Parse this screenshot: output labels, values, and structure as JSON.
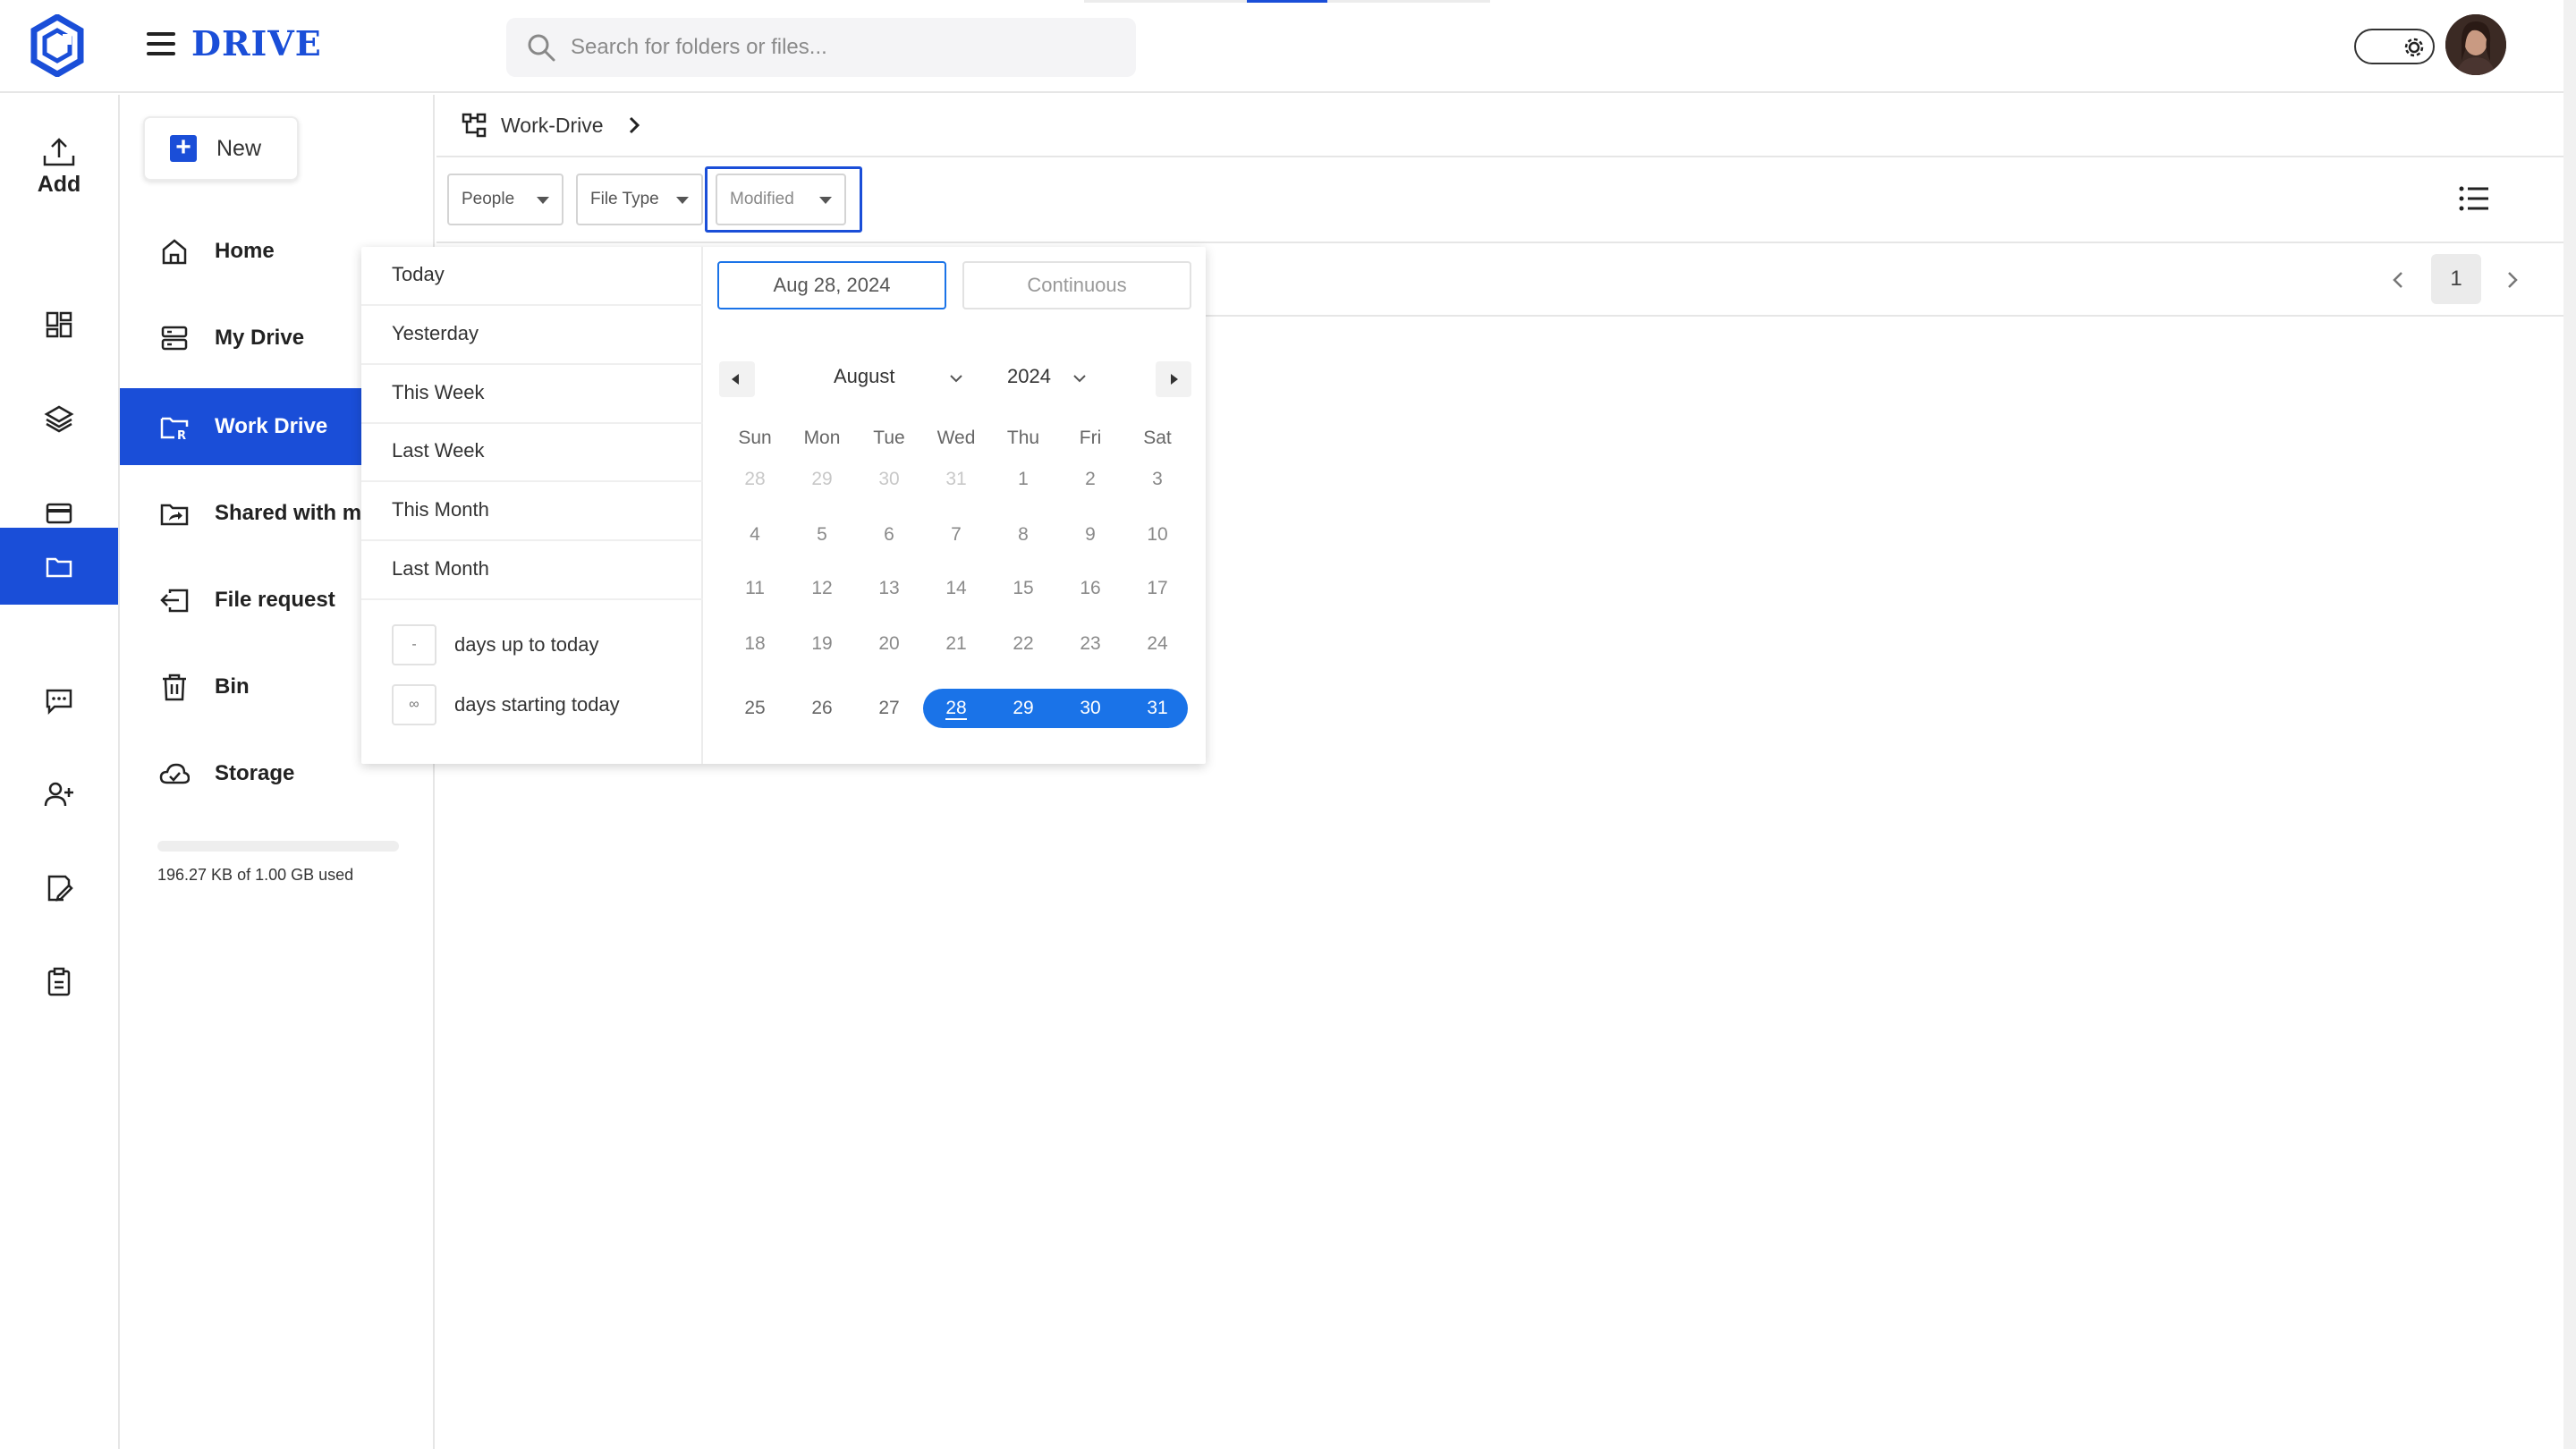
{
  "header": {
    "app_title": "DRIVE",
    "search_placeholder": "Search for folders or files..."
  },
  "rail": {
    "add_label": "Add",
    "items": [
      {
        "name": "dashboard-icon"
      },
      {
        "name": "layers-icon"
      },
      {
        "name": "card-icon"
      },
      {
        "name": "folder-icon",
        "active": true
      },
      {
        "name": "chat-icon"
      },
      {
        "name": "add-user-icon"
      },
      {
        "name": "edit-document-icon"
      },
      {
        "name": "clipboard-icon"
      }
    ]
  },
  "sidebar": {
    "new_label": "New",
    "items": [
      {
        "label": "Home",
        "icon": "home-icon"
      },
      {
        "label": "My Drive",
        "icon": "server-icon"
      },
      {
        "label": "Work Drive",
        "icon": "work-folder-icon",
        "active": true
      },
      {
        "label": "Shared with me",
        "icon": "shared-folder-icon"
      },
      {
        "label": "File request",
        "icon": "file-request-icon"
      },
      {
        "label": "Bin",
        "icon": "trash-icon"
      },
      {
        "label": "Storage",
        "icon": "cloud-icon"
      }
    ],
    "storage_text": "196.27 KB of 1.00 GB used",
    "storage_used_fraction": 0.0002
  },
  "breadcrumb": {
    "label": "Work-Drive"
  },
  "filters": {
    "people": "People",
    "file_type": "File Type",
    "modified": "Modified"
  },
  "pagination": {
    "current_page": "1"
  },
  "date_popover": {
    "presets": [
      "Today",
      "Yesterday",
      "This Week",
      "Last Week",
      "This Month",
      "Last Month"
    ],
    "days_up_value": "-",
    "days_up_label": "days up to today",
    "days_start_value": "∞",
    "days_start_label": "days starting today",
    "start_date": "Aug 28, 2024",
    "end_date": "Continuous",
    "month": "August",
    "year": "2024",
    "weekdays": [
      "Sun",
      "Mon",
      "Tue",
      "Wed",
      "Thu",
      "Fri",
      "Sat"
    ],
    "weeks": [
      [
        "28",
        "29",
        "30",
        "31",
        "1",
        "2",
        "3"
      ],
      [
        "4",
        "5",
        "6",
        "7",
        "8",
        "9",
        "10"
      ],
      [
        "11",
        "12",
        "13",
        "14",
        "15",
        "16",
        "17"
      ],
      [
        "18",
        "19",
        "20",
        "21",
        "22",
        "23",
        "24"
      ],
      [
        "25",
        "26",
        "27",
        "28",
        "29",
        "30",
        "31"
      ]
    ],
    "selected_range": [
      "28",
      "29",
      "30",
      "31"
    ],
    "colors": {
      "accent": "#1a73e8",
      "brand": "#1a4ed8"
    }
  }
}
